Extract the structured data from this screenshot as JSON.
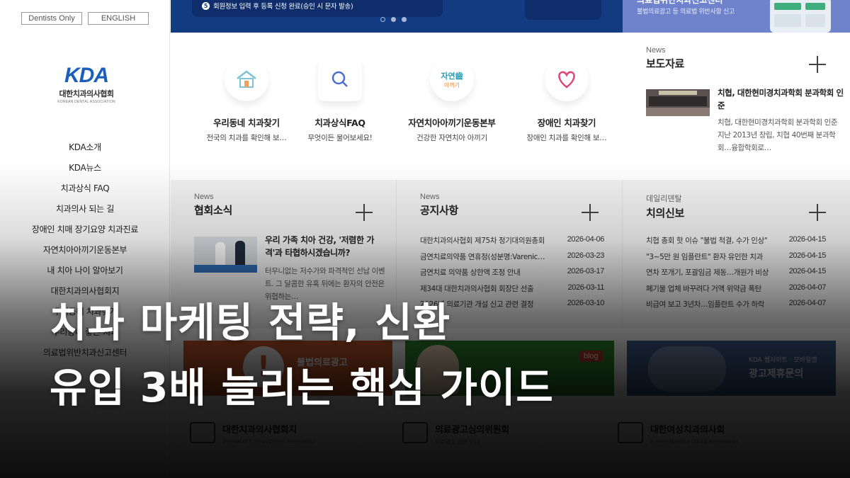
{
  "sidebar": {
    "top_links": {
      "dentists_only": "Dentists Only",
      "english": "ENGLISH"
    },
    "logo": {
      "mark": "KDA",
      "name_ko": "대한치과의사협회",
      "name_en": "KOREAN DENTAL ASSOCIATION"
    },
    "nav": [
      "KDA소개",
      "KDA뉴스",
      "치과상식 FAQ",
      "치과의사 되는 길",
      "장애인 치매 장기요양 치과진료",
      "자연치아아끼기운동본부",
      "내 치아 나이 알아보기",
      "대한치과의사협회지",
      "우리동네 치과찾기",
      "우리동네 좋은 치과",
      "의료법위반치과신고센터"
    ]
  },
  "banner": {
    "step_number": "5",
    "step_text": "회원정보 입력 후 등록 신청 완료(승인 시 문자 발송)",
    "right_title": "의료법위반치과신고센터",
    "right_text": "불법의료광고 등 의료법 위반사항 신고"
  },
  "quick": [
    {
      "title": "우리동네 치과찾기",
      "desc": "전국의 치과를 확인해 보…",
      "icon": "map-dental-icon"
    },
    {
      "title": "치과상식FAQ",
      "desc": "무엇이든 물어보세요!",
      "icon": "search-q-icon"
    },
    {
      "title": "자연치아아끼기운동본부",
      "desc": "건강한 자연치아 아끼기",
      "icon": "natural-teeth-icon"
    },
    {
      "title": "장애인 치과찾기",
      "desc": "장애인 치과를 확인해 보…",
      "icon": "heart-icon"
    }
  ],
  "press": {
    "kicker": "News",
    "title": "보도자료",
    "item_title": "치협, 대한현미경치과학회 분과학회 인준",
    "item_body": "치협, 대한현미경치과학회 분과학회 인준지난 2013년 창립, 치협 40번째 분과학회…융합학회로…"
  },
  "association": {
    "kicker": "News",
    "title": "협회소식",
    "item_title": "우리 가족 치아 건강, '저렴한 가격'과 타협하시겠습니까?",
    "item_body": "터무니없는 저수가와 파격적인 선납 이벤트. 그 달콤한 유혹 뒤에는 환자의 안전은 위협하는…"
  },
  "notices": {
    "kicker": "News",
    "title": "공지사항",
    "items": [
      {
        "title": "대한치과의사협회 제75차 정기대의원총회",
        "date": "2026-04-06"
      },
      {
        "title": "금연치료의약품 연휴정(성분명:Varenicline)",
        "date": "2026-03-23"
      },
      {
        "title": "금연치료 의약품 상한액 조정 안내",
        "date": "2026-03-17"
      },
      {
        "title": "제34대 대한치과의사협회 회장단 선출",
        "date": "2026-03-11"
      },
      {
        "title": "2026년 의료기관 개설 신고 관련 결정",
        "date": "2026-03-10"
      }
    ]
  },
  "daily": {
    "kicker": "데일리덴탈",
    "title": "치의신보",
    "items": [
      {
        "title": "치협 총회 핫 이슈 \"불법 척결, 수가 인상\"",
        "date": "2026-04-15"
      },
      {
        "title": "\"3~5만 원 임플란트\" 환자 유인한 치과",
        "date": "2026-04-15"
      },
      {
        "title": "연차 쪼개기, 포괄임금 제동…개원가 비상",
        "date": "2026-04-15"
      },
      {
        "title": "폐기물 업체 바꾸려다 거액 위약금 폭탄",
        "date": "2026-04-07"
      },
      {
        "title": "비급여 보고 3년차…임플란트 수가 하락",
        "date": "2026-04-07"
      }
    ]
  },
  "ads": {
    "ad1": "불법의료광고",
    "ad2_badge": "blog",
    "ad3_small": "KDA 웹사이트 · 모바일앱",
    "ad3_big": "광고제휴문의"
  },
  "bottom_links": [
    {
      "title": "대한치과의사협회지",
      "sub": "Journal of Korean Dental Association"
    },
    {
      "title": "의료광고심의위원회",
      "sub": "의료광고 심의 안내"
    },
    {
      "title": "대한여성치과의사회",
      "sub": "Korean Women Dental Association"
    }
  ],
  "overlay": {
    "line1": "치과 마케팅 전략, 신환",
    "line2": "유입 3배 늘리는 핵심 가이드"
  },
  "colors": {
    "banner_blue": "#133b82",
    "banner_lavender": "#6f82cc",
    "logo_blue": "#1b5fbd",
    "section_gray": "#f2f2f2"
  }
}
